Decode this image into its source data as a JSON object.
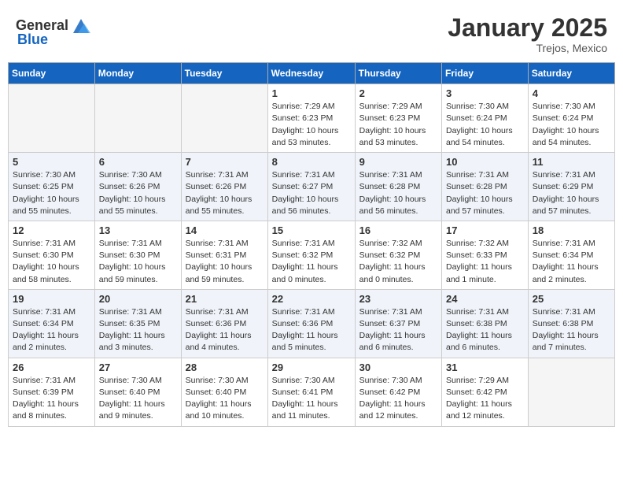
{
  "header": {
    "logo_general": "General",
    "logo_blue": "Blue",
    "month_year": "January 2025",
    "location": "Trejos, Mexico"
  },
  "weekdays": [
    "Sunday",
    "Monday",
    "Tuesday",
    "Wednesday",
    "Thursday",
    "Friday",
    "Saturday"
  ],
  "weeks": [
    [
      {
        "day": "",
        "info": ""
      },
      {
        "day": "",
        "info": ""
      },
      {
        "day": "",
        "info": ""
      },
      {
        "day": "1",
        "info": "Sunrise: 7:29 AM\nSunset: 6:23 PM\nDaylight: 10 hours\nand 53 minutes."
      },
      {
        "day": "2",
        "info": "Sunrise: 7:29 AM\nSunset: 6:23 PM\nDaylight: 10 hours\nand 53 minutes."
      },
      {
        "day": "3",
        "info": "Sunrise: 7:30 AM\nSunset: 6:24 PM\nDaylight: 10 hours\nand 54 minutes."
      },
      {
        "day": "4",
        "info": "Sunrise: 7:30 AM\nSunset: 6:24 PM\nDaylight: 10 hours\nand 54 minutes."
      }
    ],
    [
      {
        "day": "5",
        "info": "Sunrise: 7:30 AM\nSunset: 6:25 PM\nDaylight: 10 hours\nand 55 minutes."
      },
      {
        "day": "6",
        "info": "Sunrise: 7:30 AM\nSunset: 6:26 PM\nDaylight: 10 hours\nand 55 minutes."
      },
      {
        "day": "7",
        "info": "Sunrise: 7:31 AM\nSunset: 6:26 PM\nDaylight: 10 hours\nand 55 minutes."
      },
      {
        "day": "8",
        "info": "Sunrise: 7:31 AM\nSunset: 6:27 PM\nDaylight: 10 hours\nand 56 minutes."
      },
      {
        "day": "9",
        "info": "Sunrise: 7:31 AM\nSunset: 6:28 PM\nDaylight: 10 hours\nand 56 minutes."
      },
      {
        "day": "10",
        "info": "Sunrise: 7:31 AM\nSunset: 6:28 PM\nDaylight: 10 hours\nand 57 minutes."
      },
      {
        "day": "11",
        "info": "Sunrise: 7:31 AM\nSunset: 6:29 PM\nDaylight: 10 hours\nand 57 minutes."
      }
    ],
    [
      {
        "day": "12",
        "info": "Sunrise: 7:31 AM\nSunset: 6:30 PM\nDaylight: 10 hours\nand 58 minutes."
      },
      {
        "day": "13",
        "info": "Sunrise: 7:31 AM\nSunset: 6:30 PM\nDaylight: 10 hours\nand 59 minutes."
      },
      {
        "day": "14",
        "info": "Sunrise: 7:31 AM\nSunset: 6:31 PM\nDaylight: 10 hours\nand 59 minutes."
      },
      {
        "day": "15",
        "info": "Sunrise: 7:31 AM\nSunset: 6:32 PM\nDaylight: 11 hours\nand 0 minutes."
      },
      {
        "day": "16",
        "info": "Sunrise: 7:32 AM\nSunset: 6:32 PM\nDaylight: 11 hours\nand 0 minutes."
      },
      {
        "day": "17",
        "info": "Sunrise: 7:32 AM\nSunset: 6:33 PM\nDaylight: 11 hours\nand 1 minute."
      },
      {
        "day": "18",
        "info": "Sunrise: 7:31 AM\nSunset: 6:34 PM\nDaylight: 11 hours\nand 2 minutes."
      }
    ],
    [
      {
        "day": "19",
        "info": "Sunrise: 7:31 AM\nSunset: 6:34 PM\nDaylight: 11 hours\nand 2 minutes."
      },
      {
        "day": "20",
        "info": "Sunrise: 7:31 AM\nSunset: 6:35 PM\nDaylight: 11 hours\nand 3 minutes."
      },
      {
        "day": "21",
        "info": "Sunrise: 7:31 AM\nSunset: 6:36 PM\nDaylight: 11 hours\nand 4 minutes."
      },
      {
        "day": "22",
        "info": "Sunrise: 7:31 AM\nSunset: 6:36 PM\nDaylight: 11 hours\nand 5 minutes."
      },
      {
        "day": "23",
        "info": "Sunrise: 7:31 AM\nSunset: 6:37 PM\nDaylight: 11 hours\nand 6 minutes."
      },
      {
        "day": "24",
        "info": "Sunrise: 7:31 AM\nSunset: 6:38 PM\nDaylight: 11 hours\nand 6 minutes."
      },
      {
        "day": "25",
        "info": "Sunrise: 7:31 AM\nSunset: 6:38 PM\nDaylight: 11 hours\nand 7 minutes."
      }
    ],
    [
      {
        "day": "26",
        "info": "Sunrise: 7:31 AM\nSunset: 6:39 PM\nDaylight: 11 hours\nand 8 minutes."
      },
      {
        "day": "27",
        "info": "Sunrise: 7:30 AM\nSunset: 6:40 PM\nDaylight: 11 hours\nand 9 minutes."
      },
      {
        "day": "28",
        "info": "Sunrise: 7:30 AM\nSunset: 6:40 PM\nDaylight: 11 hours\nand 10 minutes."
      },
      {
        "day": "29",
        "info": "Sunrise: 7:30 AM\nSunset: 6:41 PM\nDaylight: 11 hours\nand 11 minutes."
      },
      {
        "day": "30",
        "info": "Sunrise: 7:30 AM\nSunset: 6:42 PM\nDaylight: 11 hours\nand 12 minutes."
      },
      {
        "day": "31",
        "info": "Sunrise: 7:29 AM\nSunset: 6:42 PM\nDaylight: 11 hours\nand 12 minutes."
      },
      {
        "day": "",
        "info": ""
      }
    ]
  ]
}
